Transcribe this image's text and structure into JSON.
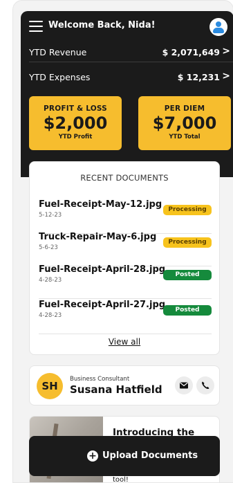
{
  "header": {
    "welcome": "Welcome Back, Nida!",
    "rows": [
      {
        "label": "YTD Revenue",
        "value": "$ 2,071,649"
      },
      {
        "label": "YTD Expenses",
        "value": "$ 12,231"
      }
    ]
  },
  "cards": [
    {
      "title": "PROFIT & LOSS",
      "value": "$2,000",
      "sub": "YTD Profit"
    },
    {
      "title": "PER DIEM",
      "value": "$7,000",
      "sub": "YTD Total"
    }
  ],
  "documents": {
    "title": "RECENT DOCUMENTS",
    "items": [
      {
        "name": "Fuel-Receipt-May-12.jpg",
        "date": "5-12-23",
        "status": "Processing"
      },
      {
        "name": "Truck-Repair-May-6.jpg",
        "date": "5-6-23",
        "status": "Processing"
      },
      {
        "name": "Fuel-Receipt-April-28.jpg",
        "date": "4-28-23",
        "status": "Posted"
      },
      {
        "name": "Fuel-Receipt-April-27.jpg",
        "date": "4-28-23",
        "status": "Posted"
      }
    ],
    "view_all": "View all"
  },
  "consultant": {
    "initials": "SH",
    "role": "Business Consultant",
    "name": "Susana Hatfield"
  },
  "promo": {
    "title": "Introducing the new",
    "tail": "tool!"
  },
  "upload": {
    "label": "Upload Documents"
  },
  "colors": {
    "accent": "#f6bd2e",
    "dark": "#1b1b1b",
    "posted": "#158a3c",
    "processing": "#f7c31d"
  },
  "icons": [
    "menu-icon",
    "user-icon",
    "chevron-right-icon",
    "mail-icon",
    "phone-icon",
    "plus-circle-icon"
  ]
}
